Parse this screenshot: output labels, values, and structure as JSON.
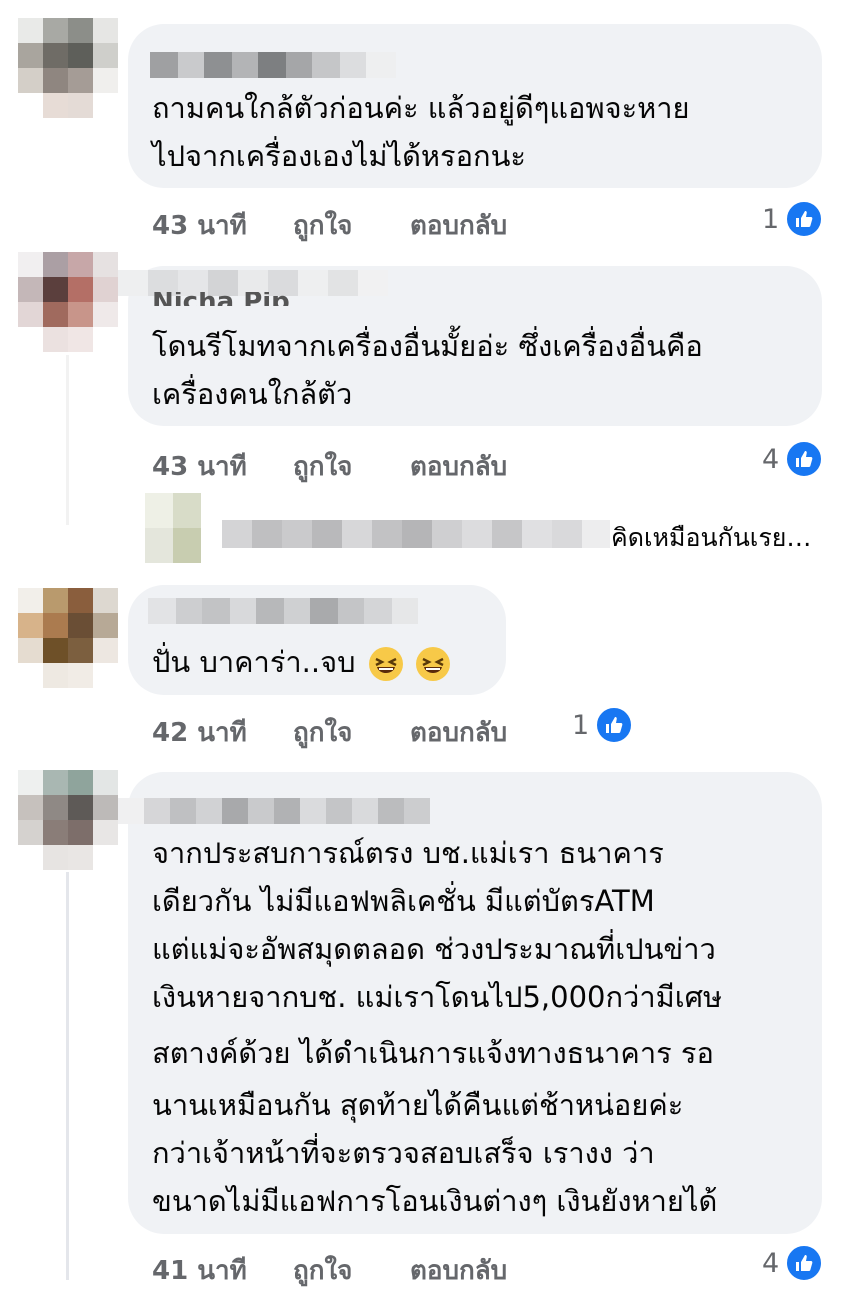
{
  "comments": [
    {
      "text_lines": [
        "ถามคนใกล้ตัวก่อนค่ะ แล้วอยู่ดีๆแอพจะหาย",
        "ไปจากเครื่องเองไม่ได้หรอกนะ"
      ],
      "time": "43 นาที",
      "like_label": "ถูกใจ",
      "reply_label": "ตอบกลับ",
      "reactions": "1"
    },
    {
      "name_partial": "Nicha Pjp",
      "text_lines": [
        "โดนรีโมทจากเครื่องอื่นมั้ยอ่ะ ซึ่งเครื่องอื่นคือ",
        "เครื่องคนใกล้ตัว"
      ],
      "time": "43 นาที",
      "like_label": "ถูกใจ",
      "reply_label": "ตอบกลับ",
      "reactions": "4"
    },
    {
      "reply_preview": "คิดเหมือนกันเรย…"
    },
    {
      "text": "ปั่น บาคาร่า..จบ",
      "emojis": [
        "laughing-emoji",
        "laughing-emoji"
      ],
      "time": "42 นาที",
      "like_label": "ถูกใจ",
      "reply_label": "ตอบกลับ",
      "reactions": "1"
    },
    {
      "text_lines": [
        "จากประสบการณ์ตรง บช.แม่เรา ธนาคาร",
        "เดียวกัน ไม่มีแอฟพลิเคชั่น มีแต่บัตรATM",
        "แต่แม่จะอัพสมุดตลอด ช่วงประมาณที่เปนข่าว",
        "เงินหายจากบช. แม่เราโดนไป5,000กว่ามีเศษ",
        "สตางค์ด้วย ได้ดำเนินการแจ้งทางธนาคาร รอ",
        "นานเหมือนกัน สุดท้ายได้คืนแต่ช้าหน่อยค่ะ",
        "กว่าเจ้าหน้าที่จะตรวจสอบเสร็จ เรางง ว่า",
        "ขนาดไม่มีแอฟการโอนเงินต่างๆ เงินยังหายได้"
      ],
      "time": "41 นาที",
      "like_label": "ถูกใจ",
      "reply_label": "ตอบกลับ",
      "reactions": "4"
    }
  ],
  "colors": {
    "bubble": "#f0f2f5",
    "meta": "#65676b",
    "like_blue": "#1877f2"
  }
}
